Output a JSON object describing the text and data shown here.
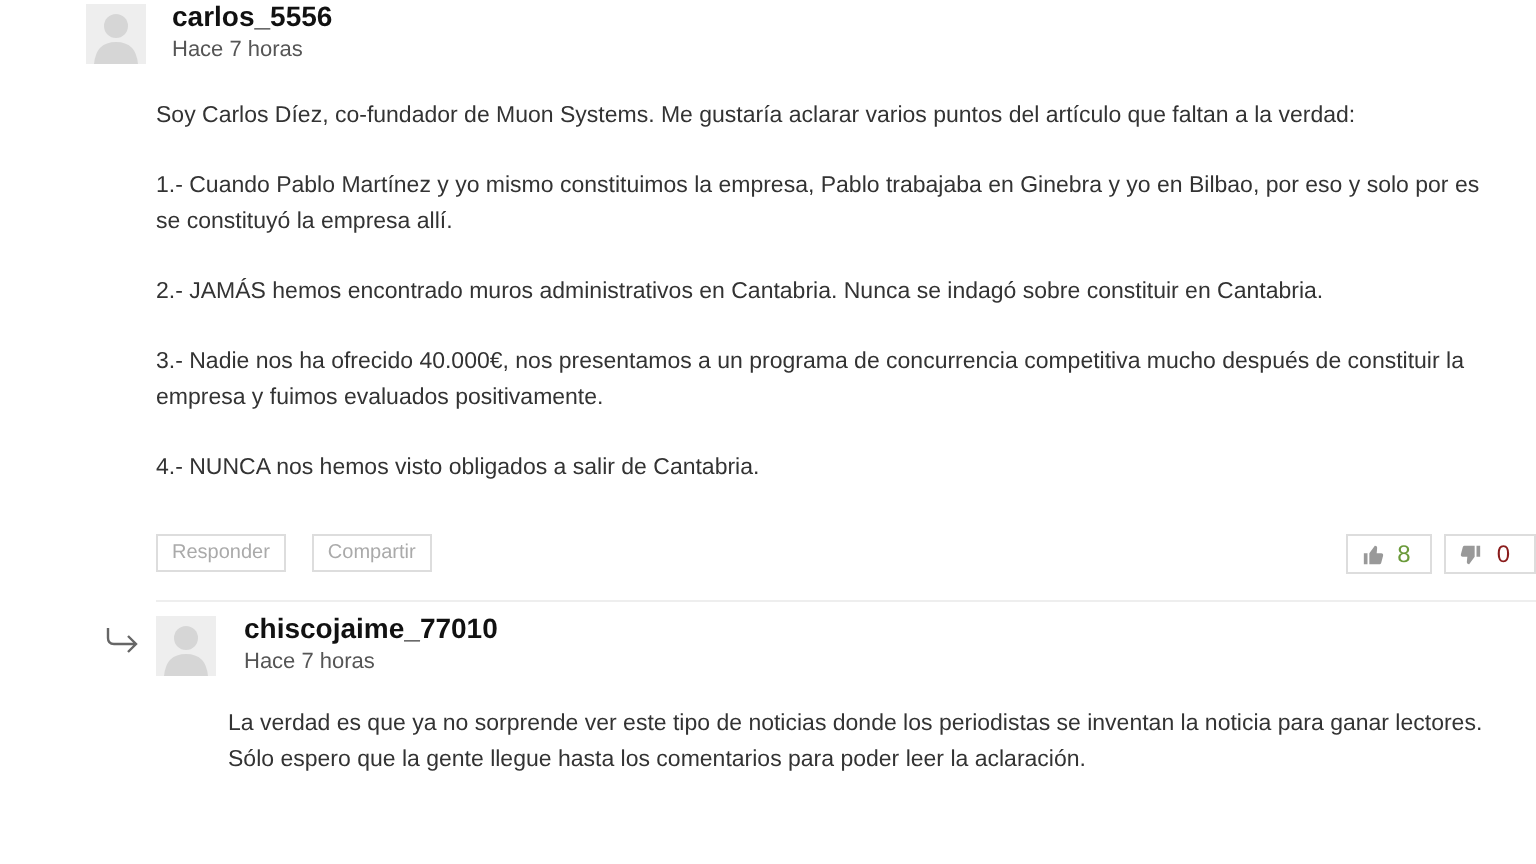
{
  "comment": {
    "author": "carlos_5556",
    "time": "Hace 7 horas",
    "paragraphs": [
      [
        "Soy Carlos Díez, co-fundador de Muon Systems. Me gustaría aclarar varios puntos del artículo que faltan a la verdad:"
      ],
      [
        "1.- Cuando Pablo Martínez y yo mismo constituimos la empresa, Pablo trabajaba en Ginebra y yo en Bilbao, por eso y solo por es",
        "se constituyó la empresa allí."
      ],
      [
        "2.- JAMÁS hemos encontrado muros administrativos en Cantabria. Nunca se indagó sobre constituir en Cantabria."
      ],
      [
        "3.- Nadie nos ha ofrecido 40.000€, nos presentamos a un programa de concurrencia competitiva mucho después de constituir la",
        "empresa y fuimos evaluados positivamente."
      ],
      [
        "4.- NUNCA nos hemos visto obligados a salir de Cantabria."
      ]
    ],
    "actions": [
      "Responder",
      "Compartir"
    ],
    "likes": "8",
    "dislikes": "0"
  },
  "reply": {
    "author": "chiscojaime_77010",
    "time": "Hace 7 horas",
    "lines": [
      "La verdad es que ya no sorprende ver este tipo de noticias donde los periodistas se inventan la noticia para ganar lectores.",
      "Sólo espero que la gente llegue hasta los comentarios para poder leer la aclaración."
    ]
  }
}
